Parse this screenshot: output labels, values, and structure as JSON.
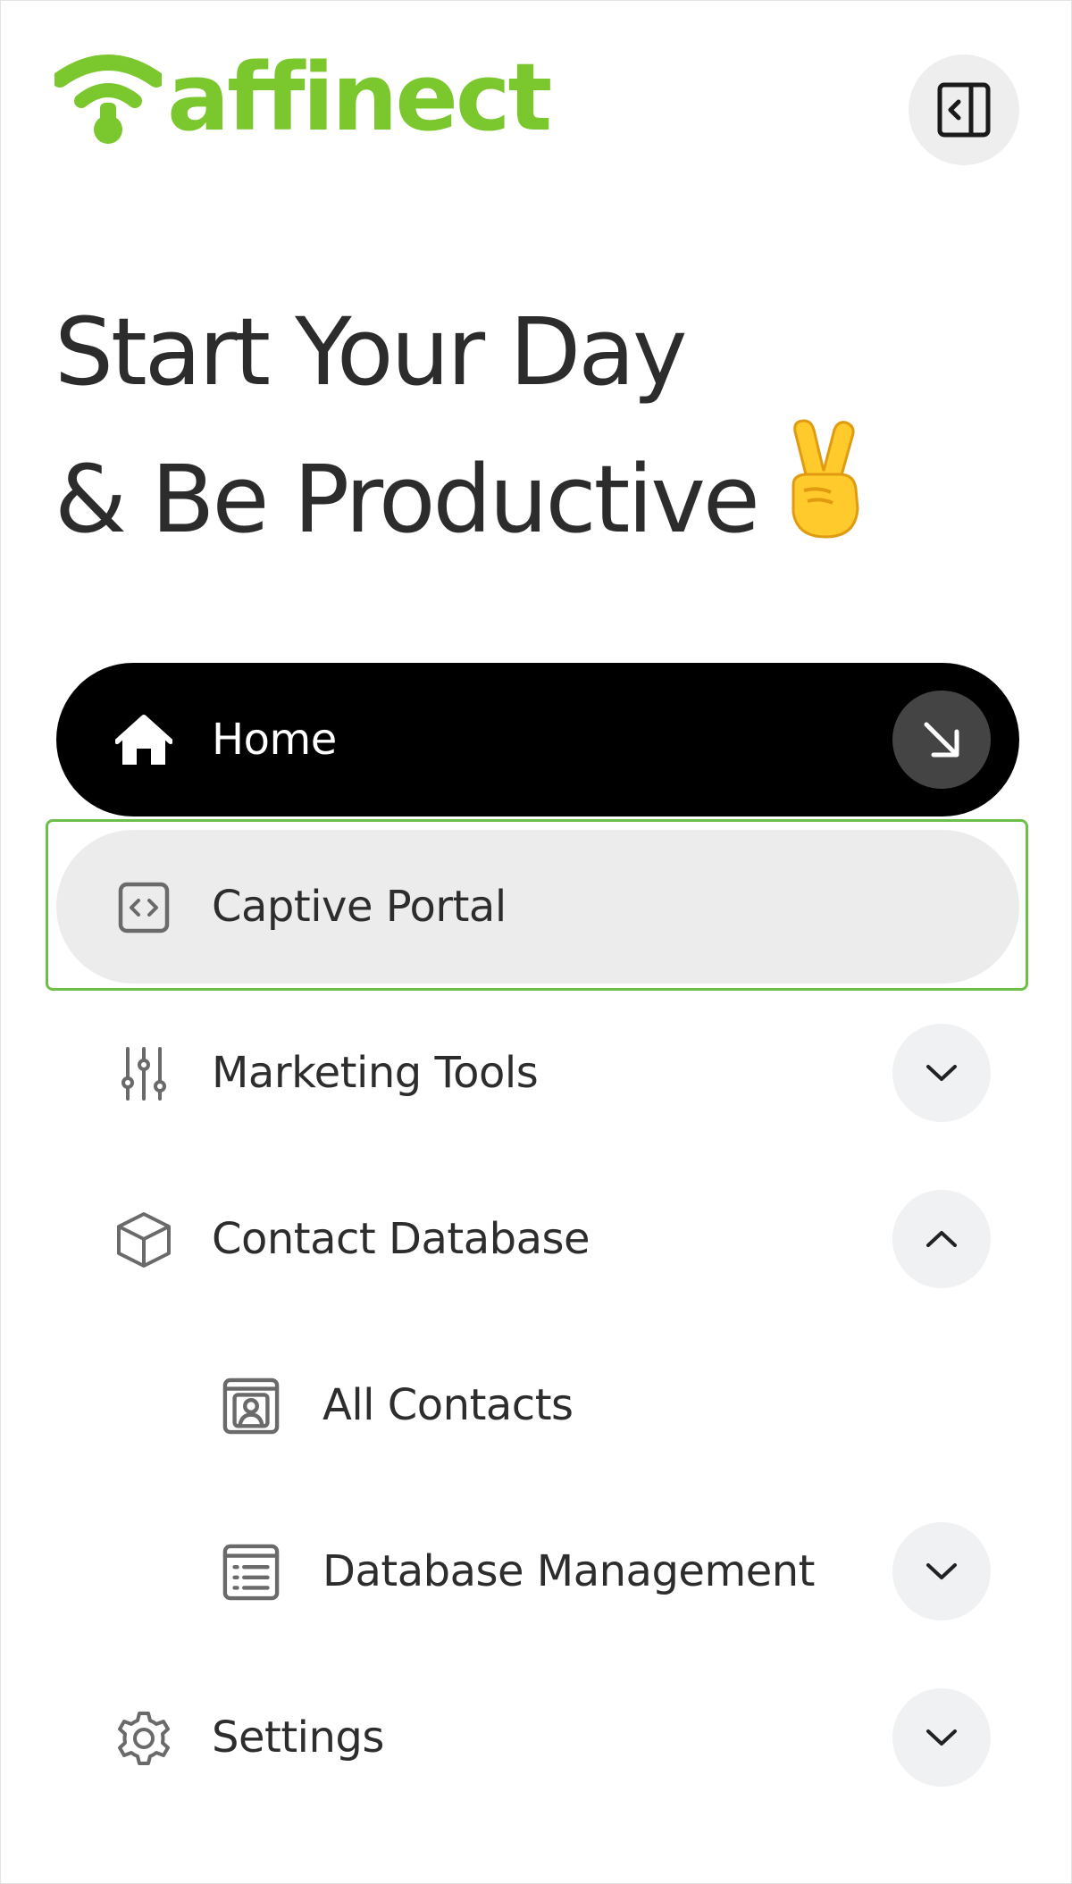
{
  "brand": {
    "name": "affinect",
    "color": "#7ac72e"
  },
  "header": {
    "collapse_icon": "sidebar-collapse-icon"
  },
  "hero": {
    "line1": "Start Your Day",
    "line2": "& Be Productive",
    "emoji": "victory-hand"
  },
  "nav": {
    "home": {
      "label": "Home",
      "icon": "home-icon",
      "action_icon": "arrow-down-right-icon"
    },
    "captive": {
      "label": "Captive Portal",
      "icon": "code-icon"
    },
    "marketing": {
      "label": "Marketing Tools",
      "icon": "sliders-icon",
      "chevron": "chevron-down-icon"
    },
    "contact": {
      "label": "Contact Database",
      "icon": "cube-icon",
      "chevron": "chevron-up-icon"
    },
    "all_contacts": {
      "label": "All Contacts",
      "icon": "contact-card-icon"
    },
    "db_management": {
      "label": "Database Management",
      "icon": "list-icon",
      "chevron": "chevron-down-icon"
    },
    "settings": {
      "label": "Settings",
      "icon": "gear-icon",
      "chevron": "chevron-down-icon"
    }
  },
  "colors": {
    "active_bg": "#000000",
    "hover_bg": "#ececec",
    "focus_outline": "#6cc04a",
    "chevron_bg": "#f0f1f3"
  }
}
